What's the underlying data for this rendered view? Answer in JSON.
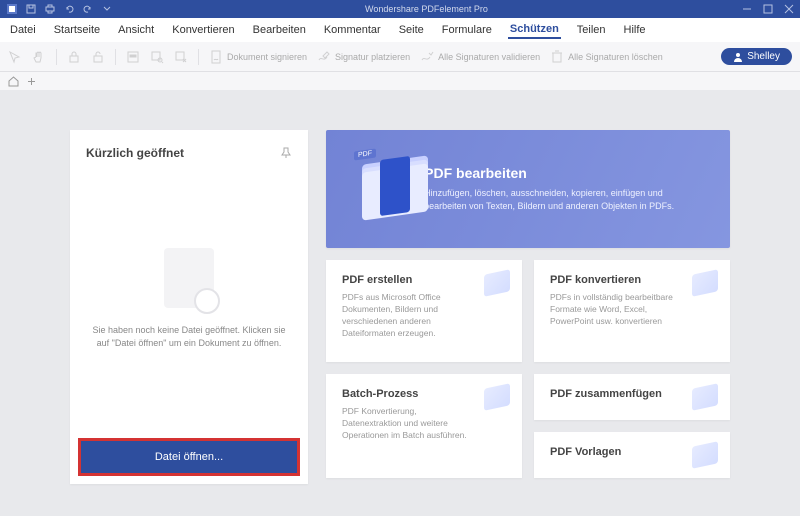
{
  "app": {
    "title": "Wondershare PDFelement Pro"
  },
  "menu": [
    "Datei",
    "Startseite",
    "Ansicht",
    "Konvertieren",
    "Bearbeiten",
    "Kommentar",
    "Seite",
    "Formulare",
    "Schützen",
    "Teilen",
    "Hilfe"
  ],
  "menu_active_index": 8,
  "toolbar": {
    "sign_doc": "Dokument signieren",
    "place_sig": "Signatur platzieren",
    "validate_all": "Alle Signaturen validieren",
    "delete_all": "Alle Signaturen löschen"
  },
  "user": {
    "name": "Shelley"
  },
  "recent": {
    "title": "Kürzlich geöffnet",
    "empty_text": "Sie haben noch keine Datei geöffnet. Klicken sie auf \"Datei öffnen\" um ein Dokument zu öffnen.",
    "open_btn": "Datei öffnen..."
  },
  "hero": {
    "title": "PDF bearbeiten",
    "desc": "Hinzufügen, löschen, ausschneiden, kopieren, einfügen und bearbeiten von Texten, Bildern und anderen Objekten in PDFs.",
    "badge": "PDF"
  },
  "cards": {
    "create": {
      "title": "PDF erstellen",
      "desc": "PDFs aus Microsoft Office Dokumenten, Bildern und verschiedenen anderen Dateiformaten erzeugen."
    },
    "convert": {
      "title": "PDF konvertieren",
      "desc": "PDFs in vollständig bearbeitbare Formate wie Word, Excel, PowerPoint usw. konvertieren"
    },
    "batch": {
      "title": "Batch-Prozess",
      "desc": "PDF Konvertierung, Datenextraktion und weitere Operationen im Batch ausführen."
    },
    "merge": {
      "title": "PDF zusammenfügen"
    },
    "templates": {
      "title": "PDF Vorlagen"
    }
  }
}
